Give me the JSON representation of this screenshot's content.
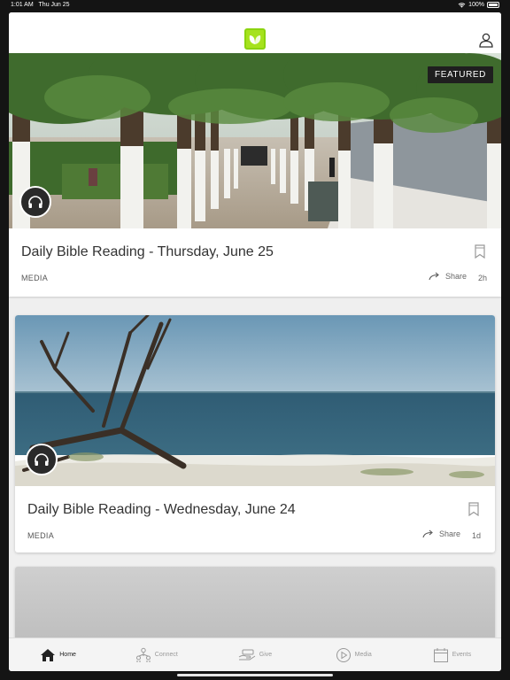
{
  "status_bar": {
    "time": "1:01 AM",
    "date": "Thu Jun 25",
    "battery": "100%"
  },
  "header": {
    "logo": "leaf-logo-icon",
    "profile_icon": "user-icon"
  },
  "feed": [
    {
      "badge": "FEATURED",
      "title": "Daily Bible Reading - Thursday, June 25",
      "category": "MEDIA",
      "share_label": "Share",
      "age": "2h"
    },
    {
      "title": "Daily Bible Reading - Wednesday, June 24",
      "category": "MEDIA",
      "share_label": "Share",
      "age": "1d"
    }
  ],
  "tabs": [
    {
      "label": "Home",
      "icon": "home-icon",
      "active": true
    },
    {
      "label": "Connect",
      "icon": "connect-icon",
      "active": false
    },
    {
      "label": "Give",
      "icon": "give-icon",
      "active": false
    },
    {
      "label": "Media",
      "icon": "play-icon",
      "active": false
    },
    {
      "label": "Events",
      "icon": "calendar-icon",
      "active": false
    }
  ],
  "colors": {
    "accent": "#a6e21d",
    "tab_active": "#222222",
    "tab_inactive": "#999999"
  }
}
